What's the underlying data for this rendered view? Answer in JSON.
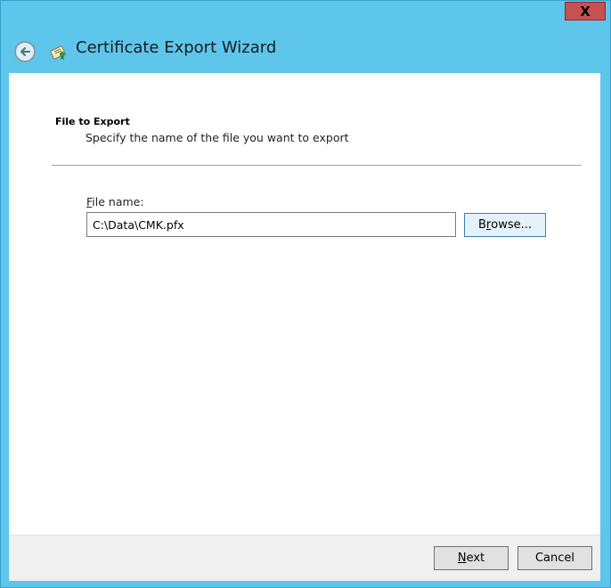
{
  "window": {
    "close_label": "X",
    "title": "Certificate Export Wizard"
  },
  "page": {
    "heading": "File to Export",
    "subheading": "Specify the name of the file you want to export"
  },
  "form": {
    "file_name_label_mnemonic": "F",
    "file_name_label_rest": "ile name:",
    "file_name_value": "C:\\Data\\CMK.pfx",
    "browse_label_pre": "B",
    "browse_label_mnemonic": "r",
    "browse_label_rest": "owse..."
  },
  "footer": {
    "next_mnemonic": "N",
    "next_rest": "ext",
    "cancel_label": "Cancel"
  },
  "colors": {
    "titlebar": "#5ec6eb",
    "close_button": "#c75050"
  }
}
